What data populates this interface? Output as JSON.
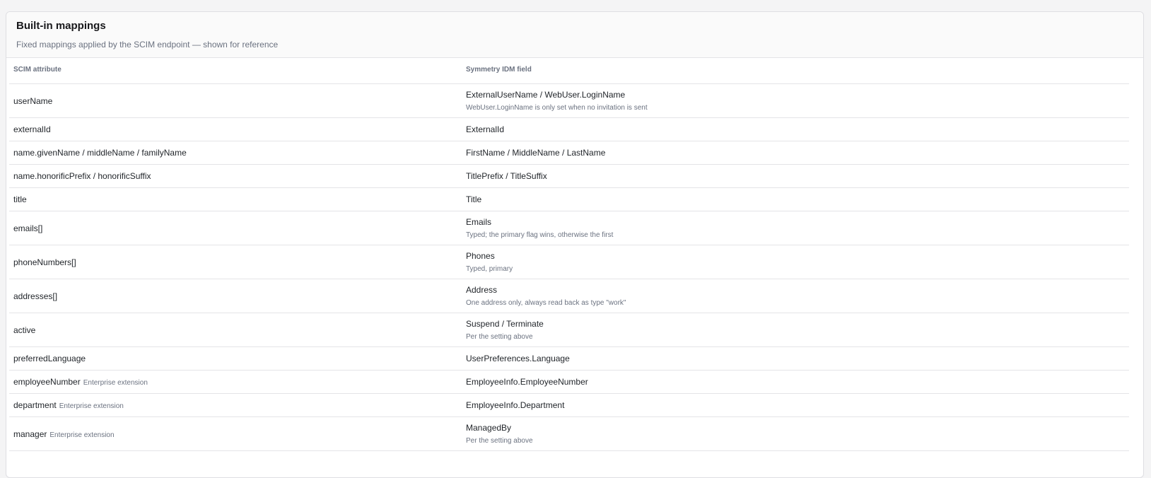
{
  "header": {
    "title": "Built-in mappings",
    "subtitle": "Fixed mappings applied by the SCIM endpoint — shown for reference"
  },
  "table": {
    "columns": [
      "SCIM attribute",
      "Symmetry IDM field"
    ],
    "rows": [
      {
        "attr": "userName",
        "badge": "",
        "field": "ExternalUserName / WebUser.LoginName",
        "note": "WebUser.LoginName is only set when no invitation is sent"
      },
      {
        "attr": "externalId",
        "badge": "",
        "field": "ExternalId",
        "note": ""
      },
      {
        "attr": "name.givenName / middleName / familyName",
        "badge": "",
        "field": "FirstName / MiddleName / LastName",
        "note": ""
      },
      {
        "attr": "name.honorificPrefix / honorificSuffix",
        "badge": "",
        "field": "TitlePrefix / TitleSuffix",
        "note": ""
      },
      {
        "attr": "title",
        "badge": "",
        "field": "Title",
        "note": ""
      },
      {
        "attr": "emails[]",
        "badge": "",
        "field": "Emails",
        "note": "Typed; the primary flag wins, otherwise the first"
      },
      {
        "attr": "phoneNumbers[]",
        "badge": "",
        "field": "Phones",
        "note": "Typed, primary"
      },
      {
        "attr": "addresses[]",
        "badge": "",
        "field": "Address",
        "note": "One address only, always read back as type \"work\""
      },
      {
        "attr": "active",
        "badge": "",
        "field": "Suspend / Terminate",
        "note": "Per the setting above"
      },
      {
        "attr": "preferredLanguage",
        "badge": "",
        "field": "UserPreferences.Language",
        "note": ""
      },
      {
        "attr": "employeeNumber",
        "badge": "Enterprise extension",
        "field": "EmployeeInfo.EmployeeNumber",
        "note": ""
      },
      {
        "attr": "department",
        "badge": "Enterprise extension",
        "field": "EmployeeInfo.Department",
        "note": ""
      },
      {
        "attr": "manager",
        "badge": "Enterprise extension",
        "field": "ManagedBy",
        "note": "Per the setting above"
      }
    ]
  }
}
